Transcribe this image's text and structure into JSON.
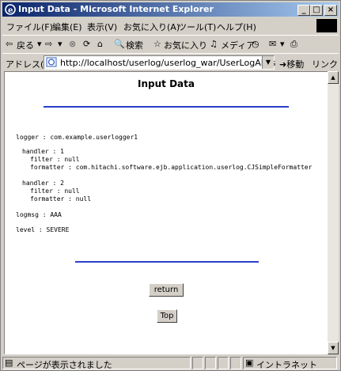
{
  "window": {
    "title": "Input Data - Microsoft Internet Explorer",
    "controls": {
      "minimize": "_",
      "maximize": "□",
      "close": "×"
    }
  },
  "menubar": {
    "items": [
      "ファイル(F)",
      "編集(E)",
      "表示(V)",
      "お気に入り(A)",
      "ツール(T)",
      "ヘルプ(H)"
    ]
  },
  "toolbar": {
    "back": "戻る",
    "search": "検索",
    "favorites": "お気に入り",
    "media": "メディア"
  },
  "addressbar": {
    "label": "アドレス(D)",
    "url": "http://localhost/userlog/userlog_war/UserLogAlias",
    "go": "移動",
    "links": "リンク »"
  },
  "page": {
    "title": "Input Data",
    "lines": [
      "logger : com.example.userlogger1",
      "handler : 1",
      "filter : null",
      "formatter : com.hitachi.software.ejb.application.userlog.CJSimpleFormatter",
      "handler : 2",
      "filter : null",
      "formatter : null",
      "logmsg : AAA",
      "level : SEVERE"
    ],
    "return_label": "return",
    "top_label": "Top"
  },
  "statusbar": {
    "text": "ページが表示されました",
    "zone": "イントラネット"
  }
}
